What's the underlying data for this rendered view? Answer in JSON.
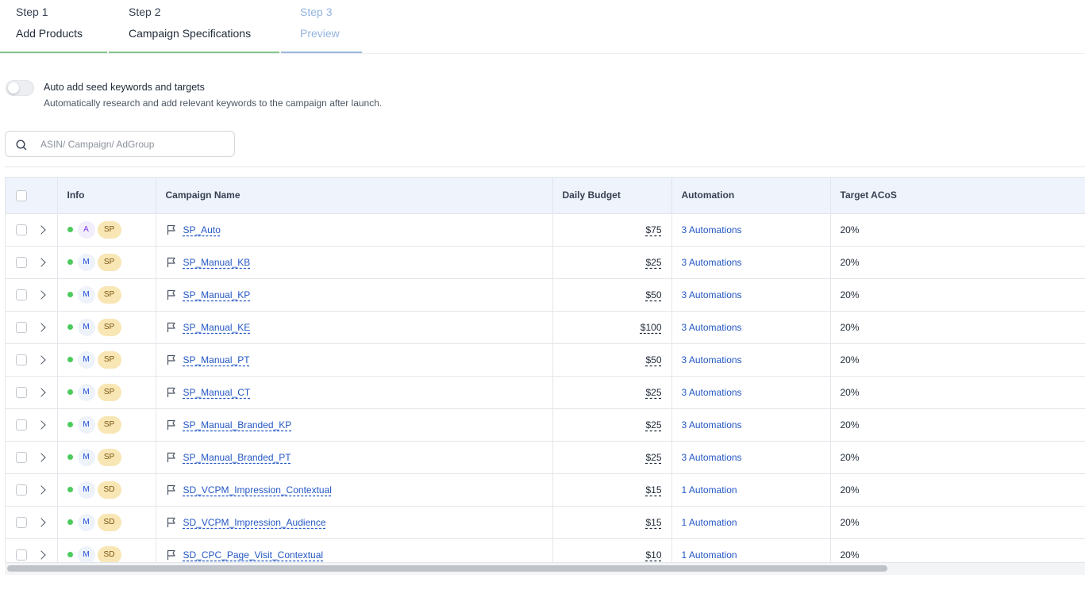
{
  "steps": [
    {
      "num": "Step 1",
      "title": "Add Products",
      "state": "complete"
    },
    {
      "num": "Step 2",
      "title": "Campaign Specifications",
      "state": "complete"
    },
    {
      "num": "Step 3",
      "title": "Preview",
      "state": "active"
    }
  ],
  "auto_seed": {
    "enabled": false,
    "title": "Auto add seed keywords and targets",
    "description": "Automatically research and add relevant keywords to the campaign after launch."
  },
  "search": {
    "placeholder": "ASIN/ Campaign/ AdGroup",
    "value": ""
  },
  "table": {
    "columns": [
      "Info",
      "Campaign Name",
      "Daily Budget",
      "Automation",
      "Target ACoS"
    ],
    "rows": [
      {
        "status": "active",
        "targeting": "A",
        "ad_type": "SP",
        "name": "SP_Auto",
        "budget": "$75",
        "automation": "3 Automations",
        "target_acos": "20%"
      },
      {
        "status": "active",
        "targeting": "M",
        "ad_type": "SP",
        "name": "SP_Manual_KB",
        "budget": "$25",
        "automation": "3 Automations",
        "target_acos": "20%"
      },
      {
        "status": "active",
        "targeting": "M",
        "ad_type": "SP",
        "name": "SP_Manual_KP",
        "budget": "$50",
        "automation": "3 Automations",
        "target_acos": "20%"
      },
      {
        "status": "active",
        "targeting": "M",
        "ad_type": "SP",
        "name": "SP_Manual_KE",
        "budget": "$100",
        "automation": "3 Automations",
        "target_acos": "20%"
      },
      {
        "status": "active",
        "targeting": "M",
        "ad_type": "SP",
        "name": "SP_Manual_PT",
        "budget": "$50",
        "automation": "3 Automations",
        "target_acos": "20%"
      },
      {
        "status": "active",
        "targeting": "M",
        "ad_type": "SP",
        "name": "SP_Manual_CT",
        "budget": "$25",
        "automation": "3 Automations",
        "target_acos": "20%"
      },
      {
        "status": "active",
        "targeting": "M",
        "ad_type": "SP",
        "name": "SP_Manual_Branded_KP",
        "budget": "$25",
        "automation": "3 Automations",
        "target_acos": "20%"
      },
      {
        "status": "active",
        "targeting": "M",
        "ad_type": "SP",
        "name": "SP_Manual_Branded_PT",
        "budget": "$25",
        "automation": "3 Automations",
        "target_acos": "20%"
      },
      {
        "status": "active",
        "targeting": "M",
        "ad_type": "SD",
        "name": "SD_VCPM_Impression_Contextual",
        "budget": "$15",
        "automation": "1 Automation",
        "target_acos": "20%"
      },
      {
        "status": "active",
        "targeting": "M",
        "ad_type": "SD",
        "name": "SD_VCPM_Impression_Audience",
        "budget": "$15",
        "automation": "1 Automation",
        "target_acos": "20%"
      },
      {
        "status": "active",
        "targeting": "M",
        "ad_type": "SD",
        "name": "SD_CPC_Page_Visit_Contextual",
        "budget": "$10",
        "automation": "1 Automation",
        "target_acos": "20%"
      }
    ]
  },
  "icons": {
    "search": "search-icon",
    "flag": "flag-icon",
    "expand": "chevron-right-icon"
  },
  "colors": {
    "step_complete": "#86c48a",
    "step_active": "#9ab7dc",
    "status_active": "#4ccb5c",
    "header_bg": "#eef3fc",
    "link": "#2357c4",
    "ad_type_badge": "#f8e6b4"
  },
  "horizontal_scroll_fraction_visible": 0.81
}
